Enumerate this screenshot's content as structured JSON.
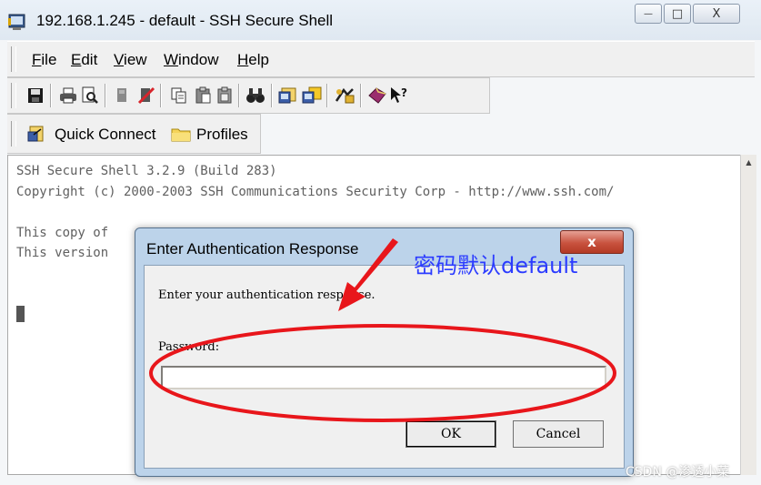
{
  "window": {
    "title": "192.168.1.245 - default - SSH Secure Shell",
    "buttons": {
      "minimize": "—",
      "maximize": "□",
      "close": "X"
    }
  },
  "menubar": {
    "items": [
      "File",
      "Edit",
      "View",
      "Window",
      "Help"
    ]
  },
  "toolbar": {
    "icons": [
      "save-icon",
      "print-icon",
      "print-preview-icon",
      "disconnect-icon",
      "connect-icon",
      "copy-icon",
      "paste-icon",
      "paste-alt-icon",
      "find-icon",
      "settings-icon",
      "new-window-icon",
      "sftp-icon",
      "help-book-icon",
      "context-help-icon"
    ]
  },
  "quickbar": {
    "quick_connect": "Quick Connect",
    "profiles": "Profiles"
  },
  "terminal": {
    "lines": [
      "SSH Secure Shell 3.2.9 (Build 283)",
      "Copyright (c) 2000-2003 SSH Communications Security Corp - http://www.ssh.com/",
      "",
      "This copy of",
      "This version"
    ]
  },
  "dialog": {
    "title": "Enter Authentication Response",
    "close_label": "x",
    "prompt": "Enter your authentication response.",
    "password_label": "Password:",
    "password_value": "",
    "ok_label": "OK",
    "cancel_label": "Cancel"
  },
  "annotation": {
    "text": "密码默认default",
    "color": "#e8161b",
    "text_color": "#2c3cff"
  },
  "watermark": {
    "text": "CSDN @渗透小菜"
  }
}
